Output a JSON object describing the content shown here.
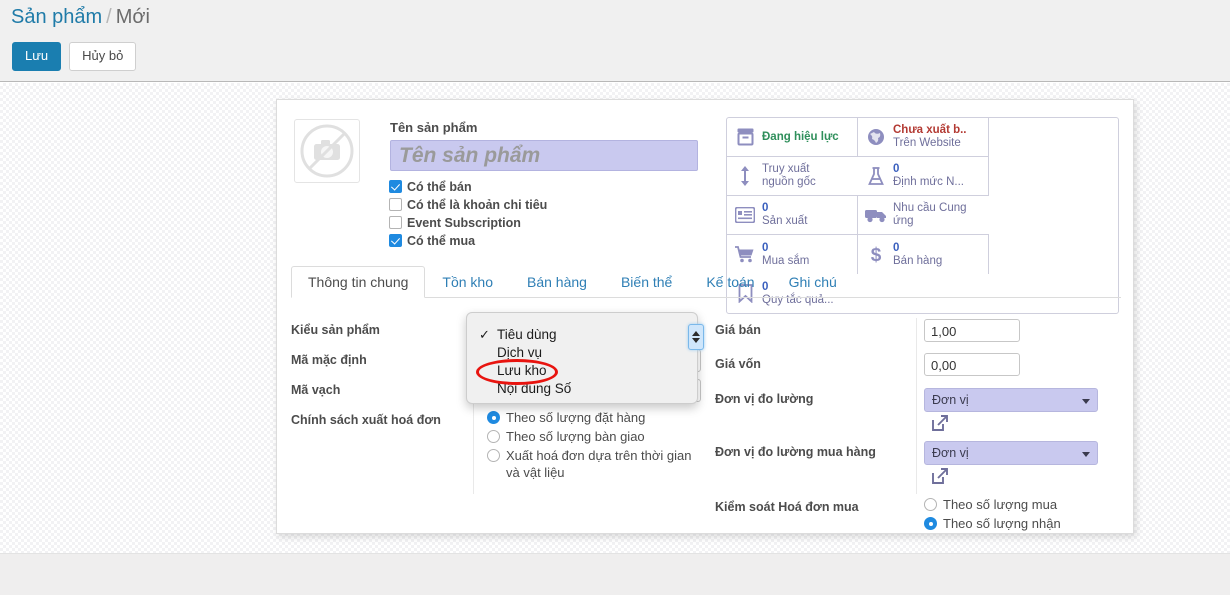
{
  "breadcrumb": {
    "root": "Sản phẩm",
    "separator": "/",
    "current": "Mới"
  },
  "actions": {
    "save": "Lưu",
    "discard": "Hủy bỏ"
  },
  "product": {
    "name_label": "Tên sản phẩm",
    "name_placeholder": "Tên sản phẩm",
    "name_value": "",
    "checkboxes": [
      {
        "label": "Có thể bán",
        "checked": true
      },
      {
        "label": "Có thể là khoản chi tiêu",
        "checked": false
      },
      {
        "label": "Event Subscription",
        "checked": false
      },
      {
        "label": "Có thể mua",
        "checked": true
      }
    ]
  },
  "smart_buttons": [
    {
      "icon": "archive-box-icon",
      "value": "Đang hiệu lực",
      "value_color": "green",
      "name": ""
    },
    {
      "icon": "globe-icon",
      "value": "Chưa xuất b..",
      "value_color": "red",
      "name": "Trên Website"
    },
    {
      "icon": "traceability-arrows-icon",
      "value": "",
      "value_color": "",
      "name": "Truy xuất nguồn gốc"
    },
    {
      "icon": "flask-icon",
      "value": "0",
      "value_color": "blue",
      "name": "Định mức N..."
    },
    {
      "icon": "list-card-icon",
      "value": "0",
      "value_color": "blue",
      "name": "Sản xuất"
    },
    {
      "icon": "truck-icon",
      "value": "",
      "value_color": "",
      "name": "Nhu cầu Cung ứng"
    },
    {
      "icon": "shopping-cart-icon",
      "value": "0",
      "value_color": "blue",
      "name": "Mua sắm"
    },
    {
      "icon": "dollar-sign-icon",
      "value": "0",
      "value_color": "blue",
      "name": "Bán hàng"
    },
    {
      "icon": "bookmark-icon",
      "value": "0",
      "value_color": "blue",
      "name": "Quy tắc quả..."
    }
  ],
  "tabs": [
    {
      "label": "Thông tin chung",
      "active": true
    },
    {
      "label": "Tồn kho",
      "active": false
    },
    {
      "label": "Bán hàng",
      "active": false
    },
    {
      "label": "Biến thể",
      "active": false
    },
    {
      "label": "Kế toán",
      "active": false
    },
    {
      "label": "Ghi chú",
      "active": false
    }
  ],
  "left_fields": {
    "product_type_label": "Kiểu sản phẩm",
    "internal_ref_label": "Mã mặc định",
    "internal_ref_value": "",
    "barcode_label": "Mã vạch",
    "barcode_value": "",
    "invoice_policy_label": "Chính sách xuất hoá đơn",
    "invoice_policy_options": [
      {
        "label": "Theo số lượng đặt hàng",
        "selected": true
      },
      {
        "label": "Theo số lượng bàn giao",
        "selected": false
      },
      {
        "label": "Xuất hoá đơn dựa trên thời gian và vật liệu",
        "selected": false
      }
    ]
  },
  "right_fields": {
    "sales_price_label": "Giá bán",
    "sales_price_value": "1,00",
    "cost_label": "Giá vốn",
    "cost_value": "0,00",
    "uom_label": "Đơn vị đo lường",
    "uom_value": "Đơn vị",
    "purchase_uom_label": "Đơn vị đo lường mua hàng",
    "purchase_uom_value": "Đơn vị",
    "purchase_control_label": "Kiểm soát Hoá đơn mua",
    "purchase_control_options": [
      {
        "label": "Theo số lượng mua",
        "selected": false
      },
      {
        "label": "Theo số lượng nhận",
        "selected": true
      }
    ]
  },
  "dropdown": {
    "open": true,
    "options": [
      {
        "label": "Tiêu dùng",
        "checked": true
      },
      {
        "label": "Dịch vụ",
        "checked": false
      },
      {
        "label": "Lưu kho",
        "checked": false
      },
      {
        "label": "Nội dung Số",
        "checked": false
      }
    ],
    "highlighted_option": "Lưu kho"
  },
  "colors": {
    "primary": "#1a7eb0",
    "link": "#2f7fb5",
    "accent_field": "#c9c9ef",
    "annotation": "#e8140f",
    "radio_on": "#1f8ae0"
  }
}
